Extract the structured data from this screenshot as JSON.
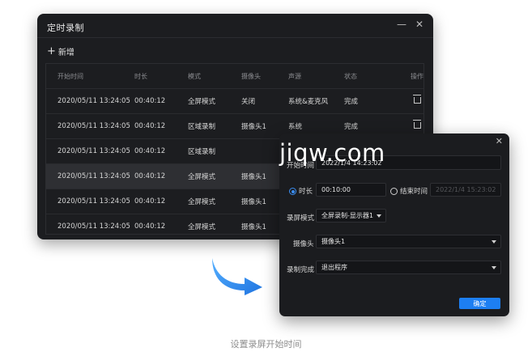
{
  "main_window": {
    "title": "定时录制",
    "add_label": "新增",
    "columns": [
      "开始时间",
      "时长",
      "模式",
      "摄像头",
      "声源",
      "状态",
      "操作"
    ],
    "rows": [
      {
        "start": "2020/05/11  13:24:05",
        "duration": "00:40:12",
        "mode": "全屏模式",
        "camera": "关闭",
        "source": "系统&麦克风",
        "status": "完成",
        "action": "trash-icon"
      },
      {
        "start": "2020/05/11  13:24:05",
        "duration": "00:40:12",
        "mode": "区域录制",
        "camera": "摄像头1",
        "source": "系统",
        "status": "完成",
        "action": "trash-icon"
      },
      {
        "start": "2020/05/11  13:24:05",
        "duration": "00:40:12",
        "mode": "区域录制",
        "camera": "",
        "source": "",
        "status": "",
        "action": ""
      },
      {
        "start": "2020/05/11  13:24:05",
        "duration": "00:40:12",
        "mode": "全屏模式",
        "camera": "摄像头1",
        "source": "",
        "status": "",
        "action": ""
      },
      {
        "start": "2020/05/11  13:24:05",
        "duration": "00:40:12",
        "mode": "全屏模式",
        "camera": "摄像头1",
        "source": "",
        "status": "",
        "action": ""
      },
      {
        "start": "2020/05/11  13:24:05",
        "duration": "00:40:12",
        "mode": "全屏模式",
        "camera": "摄像头1",
        "source": "",
        "status": "",
        "action": ""
      }
    ],
    "selected_row_index": 3
  },
  "dialog": {
    "start_time_label": "开始时间",
    "start_time_value": "2022/1/4  14:23:02",
    "duration_label": "时长",
    "duration_value": "00:10:00",
    "duration_selected": true,
    "end_time_label": "结束时间",
    "end_time_value": "2022/1/4  15:23:02",
    "mode_label": "录屏模式",
    "mode_value": "全屏录制-显示器1",
    "camera_label": "摄像头",
    "camera_value": "摄像头1",
    "finish_label": "录制完成",
    "finish_value": "退出程序",
    "ok_label": "确定"
  },
  "watermark": "jiqw.com",
  "caption": "设置录屏开始时间",
  "colors": {
    "accent": "#1d7ff2",
    "window_bg": "#1c1d20",
    "arrow": "#2f8ff0"
  }
}
